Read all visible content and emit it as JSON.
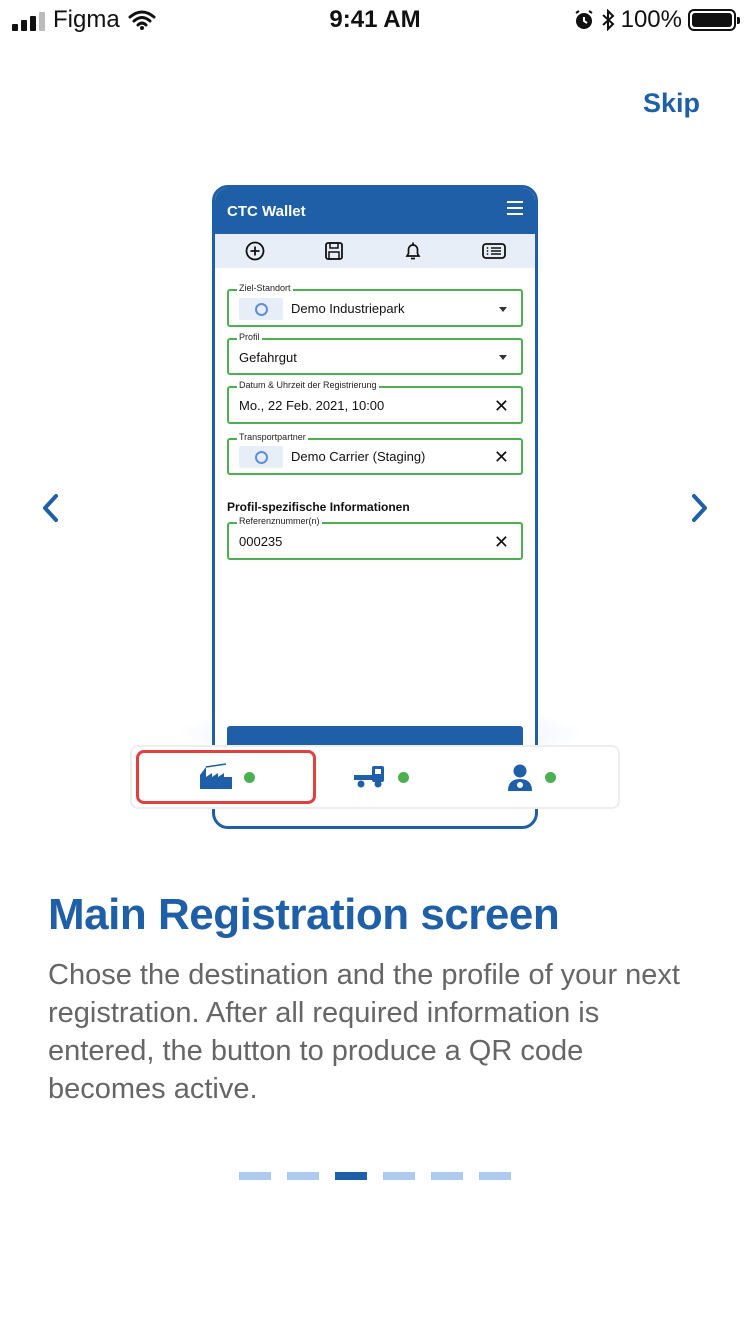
{
  "status_bar": {
    "carrier": "Figma",
    "time": "9:41 AM",
    "battery": "100%"
  },
  "skip_label": "Skip",
  "mockup": {
    "app_title": "CTC Wallet",
    "fields": [
      {
        "label": "Ziel-Standort",
        "value": "Demo Industriepark"
      },
      {
        "label": "Profil",
        "value": "Gefahrgut"
      },
      {
        "label": "Datum & Uhrzeit der Registrierung",
        "value": "Mo., 22 Feb. 2021, 10:00"
      },
      {
        "label": "Transportpartner",
        "value": "Demo Carrier (Staging)"
      }
    ],
    "section_title": "Profil-spezifische Informationen",
    "reference_field": {
      "label": "Referenznummer(n)",
      "value": "000235"
    }
  },
  "tabs": [
    "factory-icon",
    "truck-icon",
    "driver-icon"
  ],
  "colors": {
    "accent": "#1f5fa8",
    "success": "#4caf50",
    "highlight": "#e04040",
    "pager_inactive": "#aecaf0"
  },
  "content": {
    "title": "Main Registration screen",
    "description": "Chose the destination and the profile of your next registration. After all required information is entered, the button to produce a QR code becomes active."
  },
  "pager": {
    "total": 6,
    "active_index": 2
  }
}
